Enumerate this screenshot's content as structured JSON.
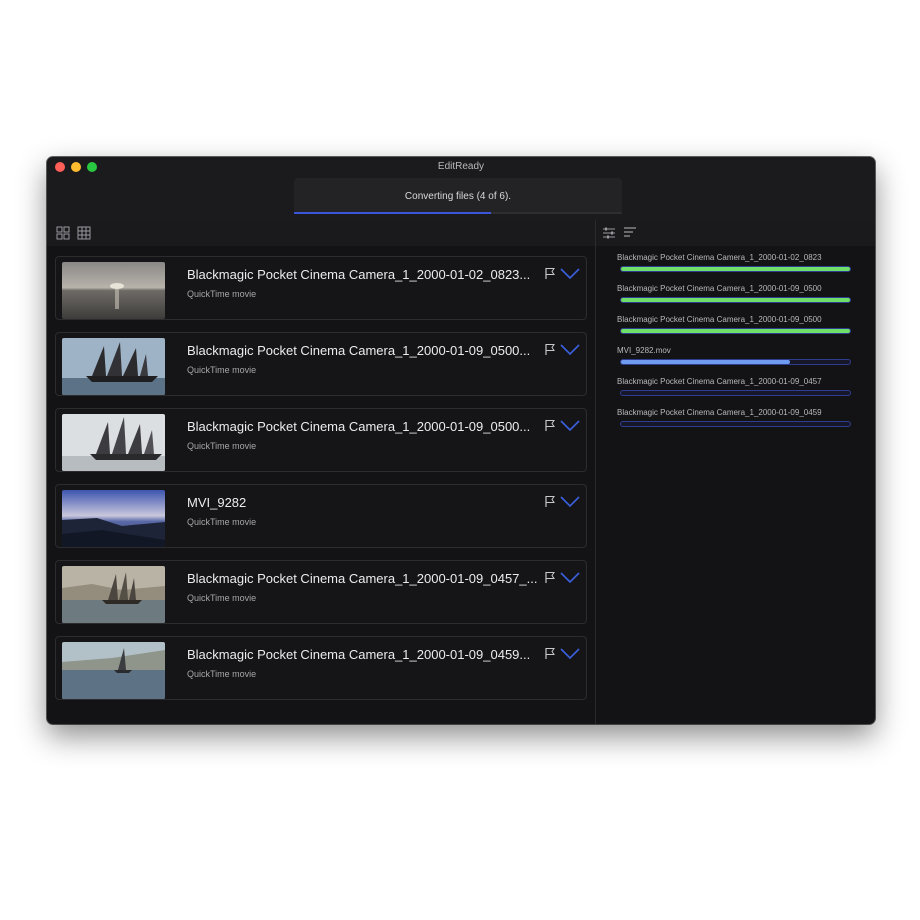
{
  "app": {
    "title": "EditReady"
  },
  "status": {
    "text": "Converting files (4 of 6).",
    "progress": 0.6,
    "accent": "#3a55d9"
  },
  "toolbar": {
    "left_icons": [
      "grid-view-icon",
      "list-view-icon"
    ],
    "right_icons": [
      "settings-sliders-icon",
      "sort-icon"
    ]
  },
  "files": [
    {
      "name": "Blackmagic Pocket Cinema Camera_1_2000-01-02_0823...",
      "type": "QuickTime movie",
      "thumb": "sunset-sea"
    },
    {
      "name": "Blackmagic Pocket Cinema Camera_1_2000-01-09_0500...",
      "type": "QuickTime movie",
      "thumb": "schooner"
    },
    {
      "name": "Blackmagic Pocket Cinema Camera_1_2000-01-09_0500...",
      "type": "QuickTime movie",
      "thumb": "schooner-bright"
    },
    {
      "name": "MVI_9282",
      "type": "QuickTime movie",
      "thumb": "twilight-shore"
    },
    {
      "name": "Blackmagic Pocket Cinema Camera_1_2000-01-09_0457_...",
      "type": "QuickTime movie",
      "thumb": "sail-haze"
    },
    {
      "name": "Blackmagic Pocket Cinema Camera_1_2000-01-09_0459...",
      "type": "QuickTime movie",
      "thumb": "sail-coast"
    }
  ],
  "queue": [
    {
      "name": "Blackmagic Pocket Cinema Camera_1_2000-01-02_0823",
      "progress": 1.0,
      "color": "#6ee06a"
    },
    {
      "name": "Blackmagic Pocket Cinema Camera_1_2000-01-09_0500",
      "progress": 1.0,
      "color": "#6ee06a"
    },
    {
      "name": "Blackmagic Pocket Cinema Camera_1_2000-01-09_0500",
      "progress": 1.0,
      "color": "#6ee06a"
    },
    {
      "name": "MVI_9282.mov",
      "progress": 0.74,
      "color": "#6f9bf0"
    },
    {
      "name": "Blackmagic Pocket Cinema Camera_1_2000-01-09_0457",
      "progress": 0.0,
      "color": "#6f9bf0"
    },
    {
      "name": "Blackmagic Pocket Cinema Camera_1_2000-01-09_0459",
      "progress": 0.0,
      "color": "#6f9bf0"
    }
  ]
}
